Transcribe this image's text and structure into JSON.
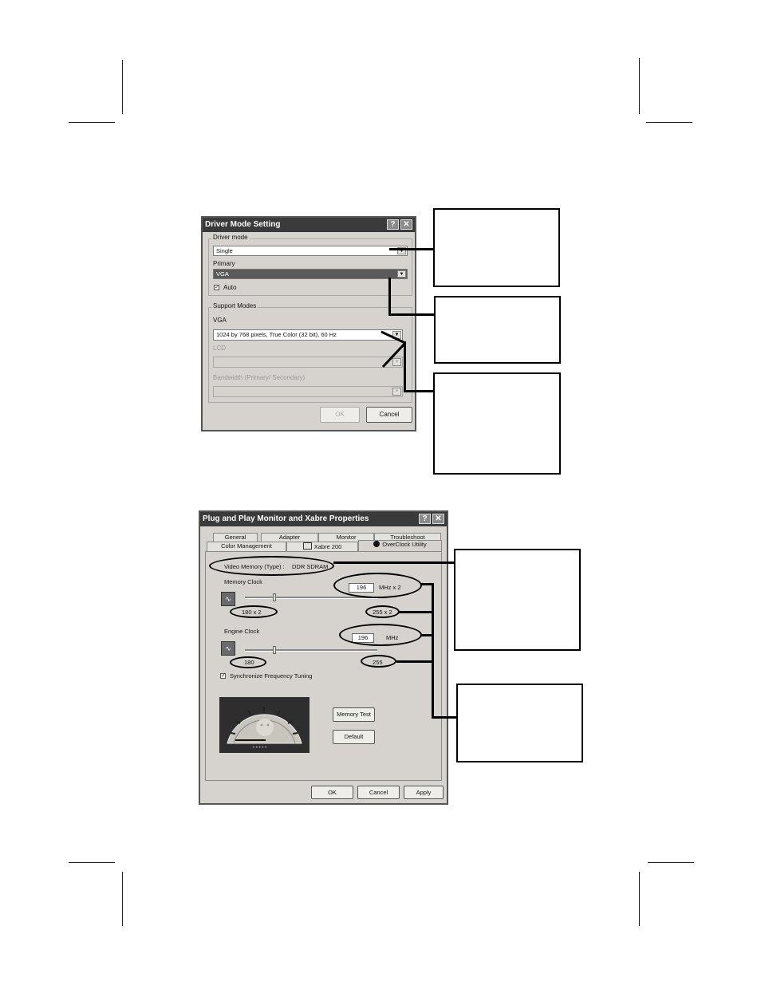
{
  "dialog1": {
    "title": "Driver Mode Setting",
    "help_label": "?",
    "close_label": "✕",
    "driver_mode_label": "Driver mode",
    "driver_mode_value": "Single",
    "primary_label": "Primary",
    "primary_value": "VGA",
    "auto_label": "Auto",
    "auto_mark": "✓",
    "support_modes_label": "Support Modes",
    "vga_label": "VGA",
    "vga_value": "1024 by 768 pixels, True Color (32 bit), 60 Hz",
    "lcd_label": "LCD",
    "bandwidth_label": "Bandwidth (Primary/ Secondary)",
    "ok_label": "OK",
    "cancel_label": "Cancel"
  },
  "dialog2": {
    "title": "Plug and Play Monitor and Xabre Properties",
    "help_label": "?",
    "close_label": "✕",
    "tabs_row1": [
      "General",
      "Adapter",
      "Monitor",
      "Troubleshoot"
    ],
    "tabs_row2": [
      "Color Management",
      "Xabre 200",
      "OverClock Utility"
    ],
    "video_memory_label": "Video Memory (Type) :",
    "video_memory_value": "DDR SDRAM",
    "memory_clock_label": "Memory Clock",
    "memory_clock_value": "196",
    "memory_clock_unit": "MHz x 2",
    "memory_min": "180 x 2",
    "memory_max": "255 x 2",
    "memory_slider_fraction": 0.21,
    "engine_clock_label": "Engine Clock",
    "engine_clock_value": "196",
    "engine_clock_unit": "MHz",
    "engine_min": "180",
    "engine_max": "255",
    "engine_slider_fraction": 0.21,
    "sync_label": "Synchronize Frequency Tuning",
    "sync_mark": "✓",
    "gauge_dots": "• • • • •",
    "memory_test_label": "Memory Test",
    "default_label": "Default",
    "ok_label": "OK",
    "cancel_label": "Cancel",
    "apply_label": "Apply"
  },
  "icons": [
    "wave-icon",
    "speedometer-icon",
    "monitor-icon",
    "overclock-icon"
  ]
}
